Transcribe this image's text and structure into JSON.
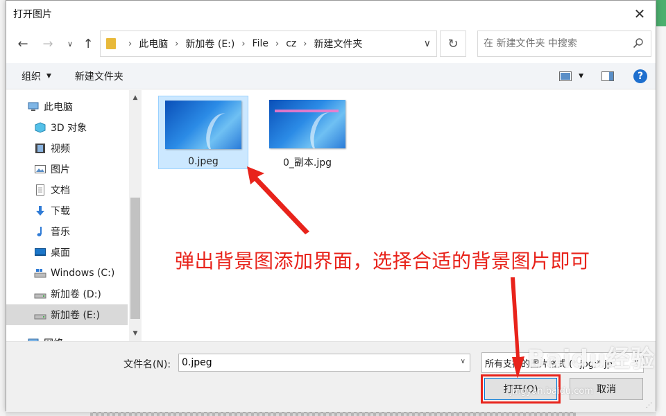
{
  "window": {
    "title": "打开图片"
  },
  "address": {
    "crumbs": [
      "此电脑",
      "新加卷 (E:)",
      "File",
      "cz",
      "新建文件夹"
    ],
    "search_placeholder": "在 新建文件夹 中搜索"
  },
  "toolbar": {
    "organize": "组织",
    "new_folder": "新建文件夹"
  },
  "nav": {
    "items": [
      {
        "label": "此电脑",
        "icon": "computer-icon"
      },
      {
        "label": "3D 对象",
        "icon": "cube-icon"
      },
      {
        "label": "视频",
        "icon": "film-icon"
      },
      {
        "label": "图片",
        "icon": "picture-icon"
      },
      {
        "label": "文档",
        "icon": "document-icon"
      },
      {
        "label": "下载",
        "icon": "download-arrow-icon"
      },
      {
        "label": "音乐",
        "icon": "music-note-icon"
      },
      {
        "label": "桌面",
        "icon": "desktop-icon"
      },
      {
        "label": "Windows (C:)",
        "icon": "windows-drive-icon"
      },
      {
        "label": "新加卷 (D:)",
        "icon": "drive-icon"
      },
      {
        "label": "新加卷 (E:)",
        "icon": "drive-icon"
      },
      {
        "label": "网络",
        "icon": "network-icon"
      }
    ]
  },
  "files": [
    {
      "name": "0.jpeg",
      "selected": true
    },
    {
      "name": "0_副本.jpg",
      "selected": false
    }
  ],
  "annotation": {
    "text": "弹出背景图添加界面，选择合适的背景图片即可",
    "color": "#e8231b"
  },
  "footer": {
    "filename_label": "文件名(N):",
    "filename_value": "0.jpeg",
    "filetype": "所有支持的图片格式 (*.jpg;*.jp",
    "open_label": "打开(O)",
    "cancel_label": "取消"
  },
  "watermark": {
    "text": "Baidu经验",
    "url_text": "jingyan.baidu.com"
  },
  "colors": {
    "accent": "#1e6fce",
    "selection": "#cce8ff",
    "annotation": "#e8231b"
  }
}
